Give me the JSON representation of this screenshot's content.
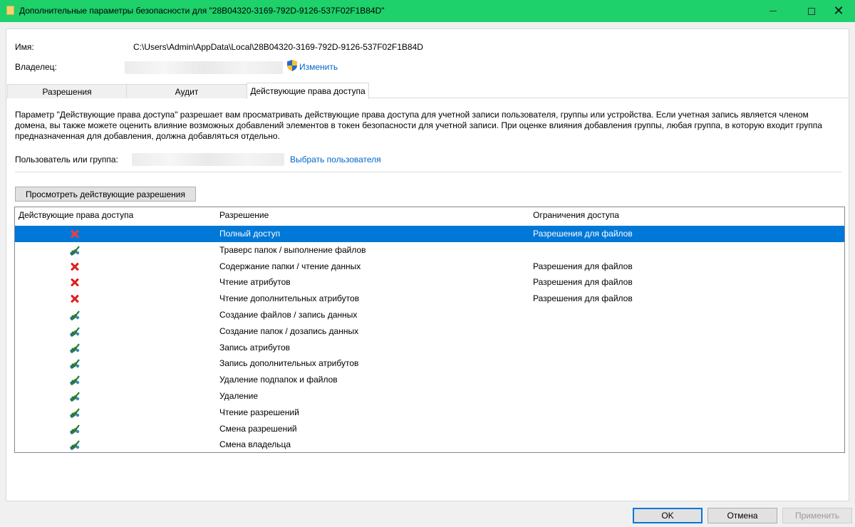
{
  "window": {
    "title": "Дополнительные параметры безопасности  для \"28B04320-3169-792D-9126-537F02F1B84D\"",
    "title_bar_color": "#1ed16b"
  },
  "name_row": {
    "label": "Имя:",
    "value": "C:\\Users\\Admin\\AppData\\Local\\28B04320-3169-792D-9126-537F02F1B84D"
  },
  "owner_row": {
    "label": "Владелец:",
    "change_link": "Изменить",
    "icon": "uac-shield-icon"
  },
  "tabs": [
    {
      "label": "Разрешения",
      "active": false
    },
    {
      "label": "Аудит",
      "active": false
    },
    {
      "label": "Действующие права доступа",
      "active": true
    }
  ],
  "description": "Параметр \"Действующие права доступа\" разрешает вам просматривать действующие права доступа для учетной записи пользователя, группы или устройства. Если учетная запись является членом домена, вы также можете оценить влияние возможных добавлений элементов в токен безопасности для учетной записи. При оценке влияния добавления группы, любая группа, в которую входит группа предназначенная для добавления, должна добавляться отдельно.",
  "user_row": {
    "label": "Пользователь или группа:",
    "select_link": "Выбрать пользователя"
  },
  "view_button": "Просмотреть действующие разрешения",
  "list": {
    "columns": [
      "Действующие права доступа",
      "Разрешение",
      "Ограничения доступа"
    ],
    "rows": [
      {
        "status": "denied",
        "permission": "Полный доступ",
        "restriction": "Разрешения для файлов",
        "selected": true
      },
      {
        "status": "allowed",
        "permission": "Траверс папок / выполнение файлов",
        "restriction": ""
      },
      {
        "status": "denied",
        "permission": "Содержание папки / чтение данных",
        "restriction": "Разрешения для файлов"
      },
      {
        "status": "denied",
        "permission": "Чтение атрибутов",
        "restriction": "Разрешения для файлов"
      },
      {
        "status": "denied",
        "permission": "Чтение дополнительных атрибутов",
        "restriction": "Разрешения для файлов"
      },
      {
        "status": "allowed",
        "permission": "Создание файлов / запись данных",
        "restriction": ""
      },
      {
        "status": "allowed",
        "permission": "Создание папок / дозапись данных",
        "restriction": ""
      },
      {
        "status": "allowed",
        "permission": "Запись атрибутов",
        "restriction": ""
      },
      {
        "status": "allowed",
        "permission": "Запись дополнительных атрибутов",
        "restriction": ""
      },
      {
        "status": "allowed",
        "permission": "Удаление подпапок и файлов",
        "restriction": ""
      },
      {
        "status": "allowed",
        "permission": "Удаление",
        "restriction": ""
      },
      {
        "status": "allowed",
        "permission": "Чтение разрешений",
        "restriction": ""
      },
      {
        "status": "allowed",
        "permission": "Смена разрешений",
        "restriction": ""
      },
      {
        "status": "allowed",
        "permission": "Смена владельца",
        "restriction": ""
      }
    ]
  },
  "footer": {
    "ok": "OK",
    "cancel": "Отмена",
    "apply": "Применить"
  }
}
